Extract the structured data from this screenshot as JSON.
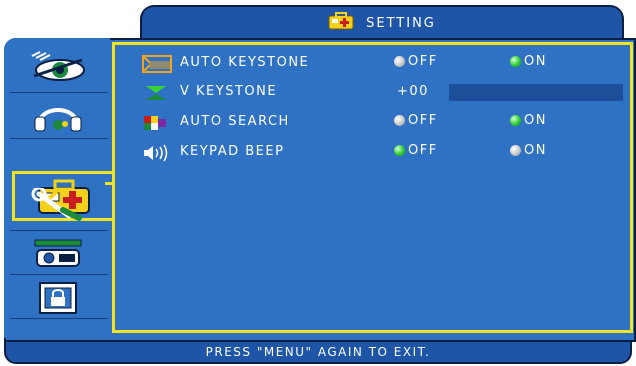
{
  "header": {
    "title": "SETTING",
    "icon": "setting-toolbox-icon"
  },
  "sidebar": {
    "items": [
      {
        "name": "image-eye-icon"
      },
      {
        "name": "audio-headphones-icon"
      },
      {
        "name": "setting-toolbox-icon",
        "selected": true
      },
      {
        "name": "tools-wrench-icon"
      },
      {
        "name": "projector-icon"
      },
      {
        "name": "lock-icon"
      }
    ]
  },
  "menu": {
    "rows": [
      {
        "label": "AUTO KEYSTONE",
        "icon": "keystone-frame-icon",
        "options": [
          {
            "label": "OFF",
            "state": "off"
          },
          {
            "label": "ON",
            "state": "on"
          }
        ]
      },
      {
        "label": "V KEYSTONE",
        "icon": "v-keystone-icon",
        "value": "+00",
        "bar_level": 0.5
      },
      {
        "label": "AUTO SEARCH",
        "icon": "color-blocks-icon",
        "options": [
          {
            "label": "OFF",
            "state": "off"
          },
          {
            "label": "ON",
            "state": "on"
          }
        ]
      },
      {
        "label": "KEYPAD BEEP",
        "icon": "speaker-sound-icon",
        "options": [
          {
            "label": "OFF",
            "state": "on"
          },
          {
            "label": "ON",
            "state": "off"
          }
        ]
      }
    ]
  },
  "footer": {
    "text": "PRESS \"MENU\" AGAIN TO EXIT."
  },
  "colors": {
    "background": "#2f72c4",
    "header": "#1e55a6",
    "highlight": "#f2e520",
    "on": "#37d437",
    "off": "#c9c9c9"
  }
}
